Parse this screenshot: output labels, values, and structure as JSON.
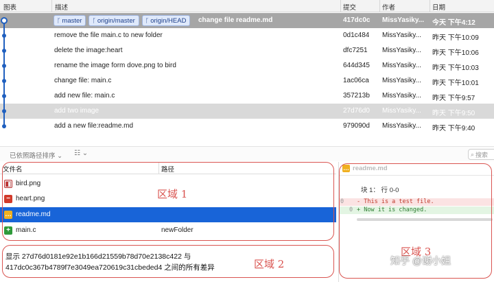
{
  "history": {
    "columns": {
      "graph": "图表",
      "description": "描述",
      "commit": "提交",
      "author": "作者",
      "date": "日期"
    },
    "head_refs": [
      {
        "glyph": "ᚴ",
        "label": "master"
      },
      {
        "glyph": "ᚴ",
        "label": "origin/master"
      },
      {
        "glyph": "ᚴ",
        "label": "origin/HEAD"
      }
    ],
    "commits": [
      {
        "message": "change file readme.md",
        "sha": "417dc0c",
        "author": "MissYasiky...",
        "date": "今天 下午4:12"
      },
      {
        "message": "remove the file main.c to new folder",
        "sha": "0d1c484",
        "author": "MissYasiky...",
        "date": "昨天 下午10:09"
      },
      {
        "message": "delete the image:heart",
        "sha": "dfc7251",
        "author": "MissYasiky...",
        "date": "昨天 下午10:06"
      },
      {
        "message": "rename the image form dove.png to bird",
        "sha": "644d345",
        "author": "MissYasiky...",
        "date": "昨天 下午10:03"
      },
      {
        "message": "change file: main.c",
        "sha": "1ac06ca",
        "author": "MissYasiky...",
        "date": "昨天 下午10:01"
      },
      {
        "message": "add new file: main.c",
        "sha": "357213b",
        "author": "MissYasiky...",
        "date": "昨天 下午9:57"
      },
      {
        "message": "add two image",
        "sha": "27d76d0",
        "author": "MissYasiky...",
        "date": "昨天 下午9:50"
      },
      {
        "message": "add a new file:readme.md",
        "sha": "979090d",
        "author": "MissYasiky...",
        "date": "昨天 下午9:40"
      }
    ]
  },
  "toolbar": {
    "sort_label": "已依照路径排序 ⌄",
    "list_icon": "☷ ⌄",
    "search_placeholder": "搜索"
  },
  "files": {
    "columns": {
      "name": "文件名",
      "path": "路径"
    },
    "rows": [
      {
        "status": "modified",
        "name": "bird.png",
        "path": ""
      },
      {
        "status": "deleted",
        "name": "heart.png",
        "path": ""
      },
      {
        "status": "changed",
        "name": "readme.md",
        "path": ""
      },
      {
        "status": "added",
        "name": "main.c",
        "path": "newFolder"
      }
    ]
  },
  "diff": {
    "file": "readme.md",
    "hunk": "块 1： 行 0-0",
    "lines": [
      {
        "type": "del",
        "old": "0",
        "new": "",
        "text": "- This is a test file."
      },
      {
        "type": "ins",
        "old": "",
        "new": "0",
        "text": "+ Now it is changed."
      }
    ]
  },
  "summary": {
    "line1": "显示 27d76d0181e92e1b166d21559b78d70e2138c422 与",
    "line2": "417dc0c367b4789f7e3049ea720619c31cbeded4 之间的所有差异"
  },
  "annotations": {
    "region1": "区域 1",
    "region2": "区域 2",
    "region3": "区域 3",
    "watermark": "知乎 @谢小姐"
  },
  "colors": {
    "selection_blue": "#1864d8",
    "graph_blue": "#1f5fbf",
    "annotation_red": "#d9534f"
  }
}
